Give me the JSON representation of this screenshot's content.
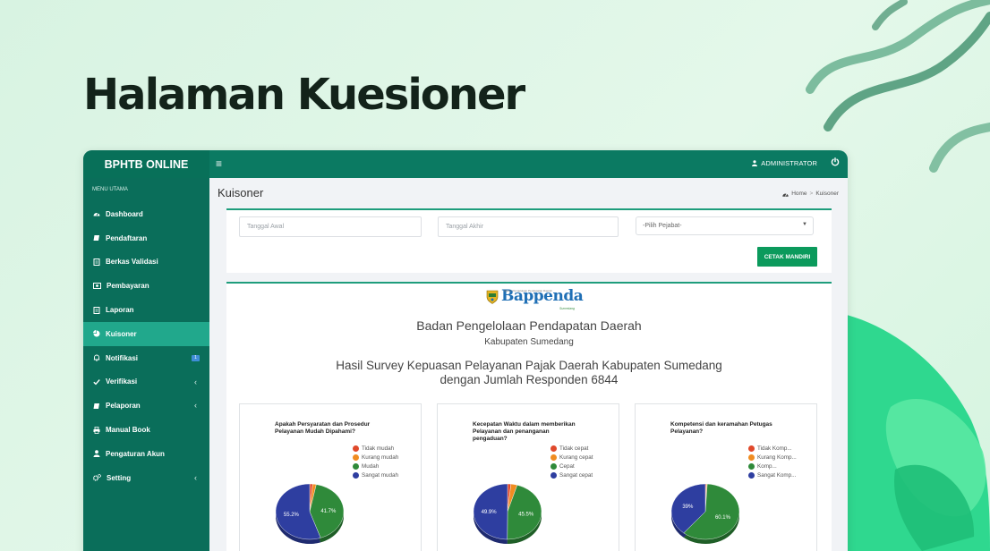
{
  "hero": {
    "title": "Halaman Kuesioner"
  },
  "app": {
    "brand": "BPHTB ONLINE",
    "user": "ADMINISTRATOR"
  },
  "sidebar": {
    "heading": "MENU UTAMA",
    "items": [
      {
        "label": "Dashboard",
        "icon": "dashboard-icon"
      },
      {
        "label": "Pendaftaran",
        "icon": "book-icon"
      },
      {
        "label": "Berkas Validasi",
        "icon": "file-icon"
      },
      {
        "label": "Pembayaran",
        "icon": "money-icon"
      },
      {
        "label": "Laporan",
        "icon": "file-icon"
      },
      {
        "label": "Kuisoner",
        "icon": "pie-chart-icon",
        "active": true
      },
      {
        "label": "Notifikasi",
        "icon": "bell-icon",
        "badge": "1"
      },
      {
        "label": "Verifikasi",
        "icon": "check-icon",
        "chevron": "‹"
      },
      {
        "label": "Pelaporan",
        "icon": "book-icon",
        "chevron": "‹"
      },
      {
        "label": "Manual Book",
        "icon": "print-icon"
      },
      {
        "label": "Pengaturan Akun",
        "icon": "user-icon"
      },
      {
        "label": "Setting",
        "icon": "cogs-icon",
        "chevron": "‹"
      }
    ]
  },
  "page": {
    "title": "Kuisoner",
    "breadcrumb": {
      "home": "Home",
      "separator": ">",
      "current": "Kuisoner"
    }
  },
  "filters": {
    "start_date_placeholder": "Tanggal Awal",
    "end_date_placeholder": "Tanggal Akhir",
    "official_select": "-Pilih Pejabat-",
    "print_button": "CETAK MANDIRI"
  },
  "report": {
    "logo_text": "Bappenda",
    "logo_tagline": "Badan Pengelolaan Pendapatan Daerah",
    "logo_region": "Sumedang",
    "org_name": "Badan Pengelolaan Pendapatan Daerah",
    "org_sub": "Kabupaten Sumedang",
    "survey_title_line1": "Hasil Survey Kepuasan Pelayanan Pajak Daerah Kabupaten Sumedang",
    "survey_title_line2": "dengan Jumlah Responden 6844"
  },
  "colors": {
    "very_low": "#e0492b",
    "low": "#f08c21",
    "good": "#2f8a3a",
    "very_good": "#2e3ea0",
    "sidebar": "#0a6e5a",
    "topbar": "#0b7a62"
  },
  "chart_data": [
    {
      "type": "pie",
      "title": "Apakah Persyaratan dan Prosedur Pelayanan Mudah Dipahami?",
      "categories": [
        "Tidak mudah",
        "Kurang mudah",
        "Mudah",
        "Sangat mudah"
      ],
      "values": [
        1.4,
        1.7,
        41.7,
        55.2
      ],
      "labels": [
        "",
        "",
        "41.7%",
        "55.2%"
      ],
      "legend_position": "right"
    },
    {
      "type": "pie",
      "title": "Kecepatan Waktu dalam memberikan Pelayanan dan penanganan pengaduan?",
      "categories": [
        "Tidak cepat",
        "Kurang cepat",
        "Cepat",
        "Sangat cepat"
      ],
      "values": [
        1.6,
        3.0,
        45.5,
        49.9
      ],
      "labels": [
        "",
        "",
        "45.5%",
        "49.9%"
      ],
      "legend_position": "right"
    },
    {
      "type": "pie",
      "title": "Kompetensi dan keramahan Petugas Pelayanan?",
      "categories": [
        "Tidak Komp...",
        "Kurang Komp...",
        "Komp...",
        "Sangat Komp..."
      ],
      "values": [
        0.5,
        0.4,
        60.1,
        39.0
      ],
      "labels": [
        "",
        "",
        "60.1%",
        "39%"
      ],
      "legend_position": "right"
    }
  ]
}
